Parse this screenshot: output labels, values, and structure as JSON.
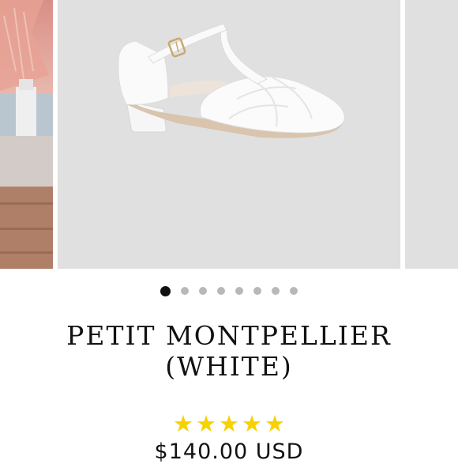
{
  "carousel": {
    "slides": [
      "side-view",
      "main-view",
      "next-view"
    ],
    "active_index": 0,
    "dot_count": 8,
    "zoom_icon": "zoom-icon"
  },
  "product": {
    "title": "PETIT MONTPELLIER (WHITE)",
    "rating": 5,
    "rating_max": 5,
    "price": "$140.00 USD"
  },
  "colors": {
    "star": "#f7d100",
    "image_background": "#e0e0e0",
    "active_dot": "#111111",
    "inactive_dot": "#b8b8b8"
  }
}
